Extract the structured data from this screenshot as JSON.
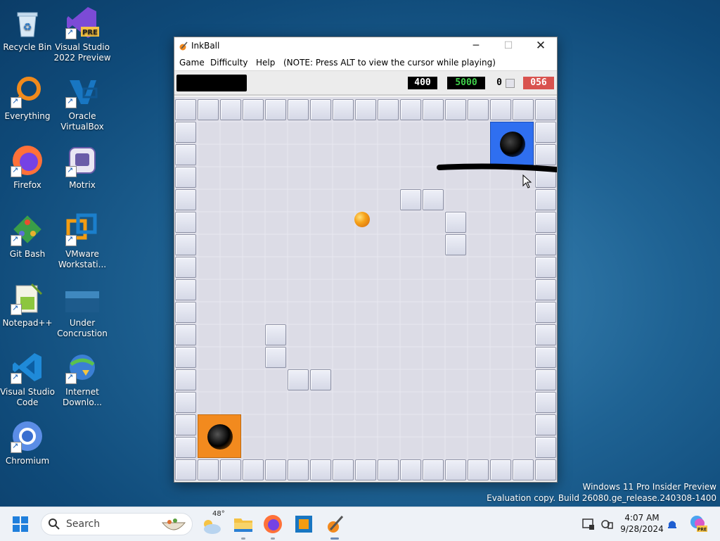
{
  "desktop": {
    "icons": [
      {
        "label": "Recycle Bin",
        "icon": "recycle-bin-icon"
      },
      {
        "label": "Visual Studio 2022 Preview",
        "icon": "visual-studio-preview-icon",
        "badge": "PRE"
      },
      {
        "label": "Everything",
        "icon": "everything-search-icon"
      },
      {
        "label": "Oracle VirtualBox",
        "icon": "virtualbox-icon"
      },
      {
        "label": "Firefox",
        "icon": "firefox-icon"
      },
      {
        "label": "Motrix",
        "icon": "motrix-icon"
      },
      {
        "label": "Git Bash",
        "icon": "git-bash-icon"
      },
      {
        "label": "VMware Workstati...",
        "icon": "vmware-icon"
      },
      {
        "label": "Notepad++",
        "icon": "notepad-plus-plus-icon"
      },
      {
        "label": "Under Concrustion",
        "icon": "folder-image-icon"
      },
      {
        "label": "Visual Studio Code",
        "icon": "vscode-icon"
      },
      {
        "label": "Internet Downlo...",
        "icon": "internet-download-manager-icon"
      },
      {
        "label": "Chromium",
        "icon": "chromium-icon"
      }
    ]
  },
  "window": {
    "title": "InkBall",
    "menu": {
      "game": "Game",
      "difficulty": "Difficulty",
      "help": "Help",
      "note": "(NOTE: Press ALT to view the cursor while playing)"
    },
    "toolbar": {
      "score": "400",
      "target": "5000",
      "counter": "0",
      "timer": "056"
    },
    "colors": {
      "target": "#3fd24a",
      "timer_bg": "#d9534f",
      "blue_hole": "#2f6ff0",
      "orange_hole": "#f28a1e",
      "ball": "#f39a12"
    }
  },
  "watermark": {
    "line1": "Windows 11 Pro Insider Preview",
    "line2": "Evaluation copy. Build 26080.ge_release.240308-1400"
  },
  "taskbar": {
    "search_placeholder": "Search",
    "weather_temp": "48°",
    "time": "4:07 AM",
    "date": "9/28/2024"
  }
}
